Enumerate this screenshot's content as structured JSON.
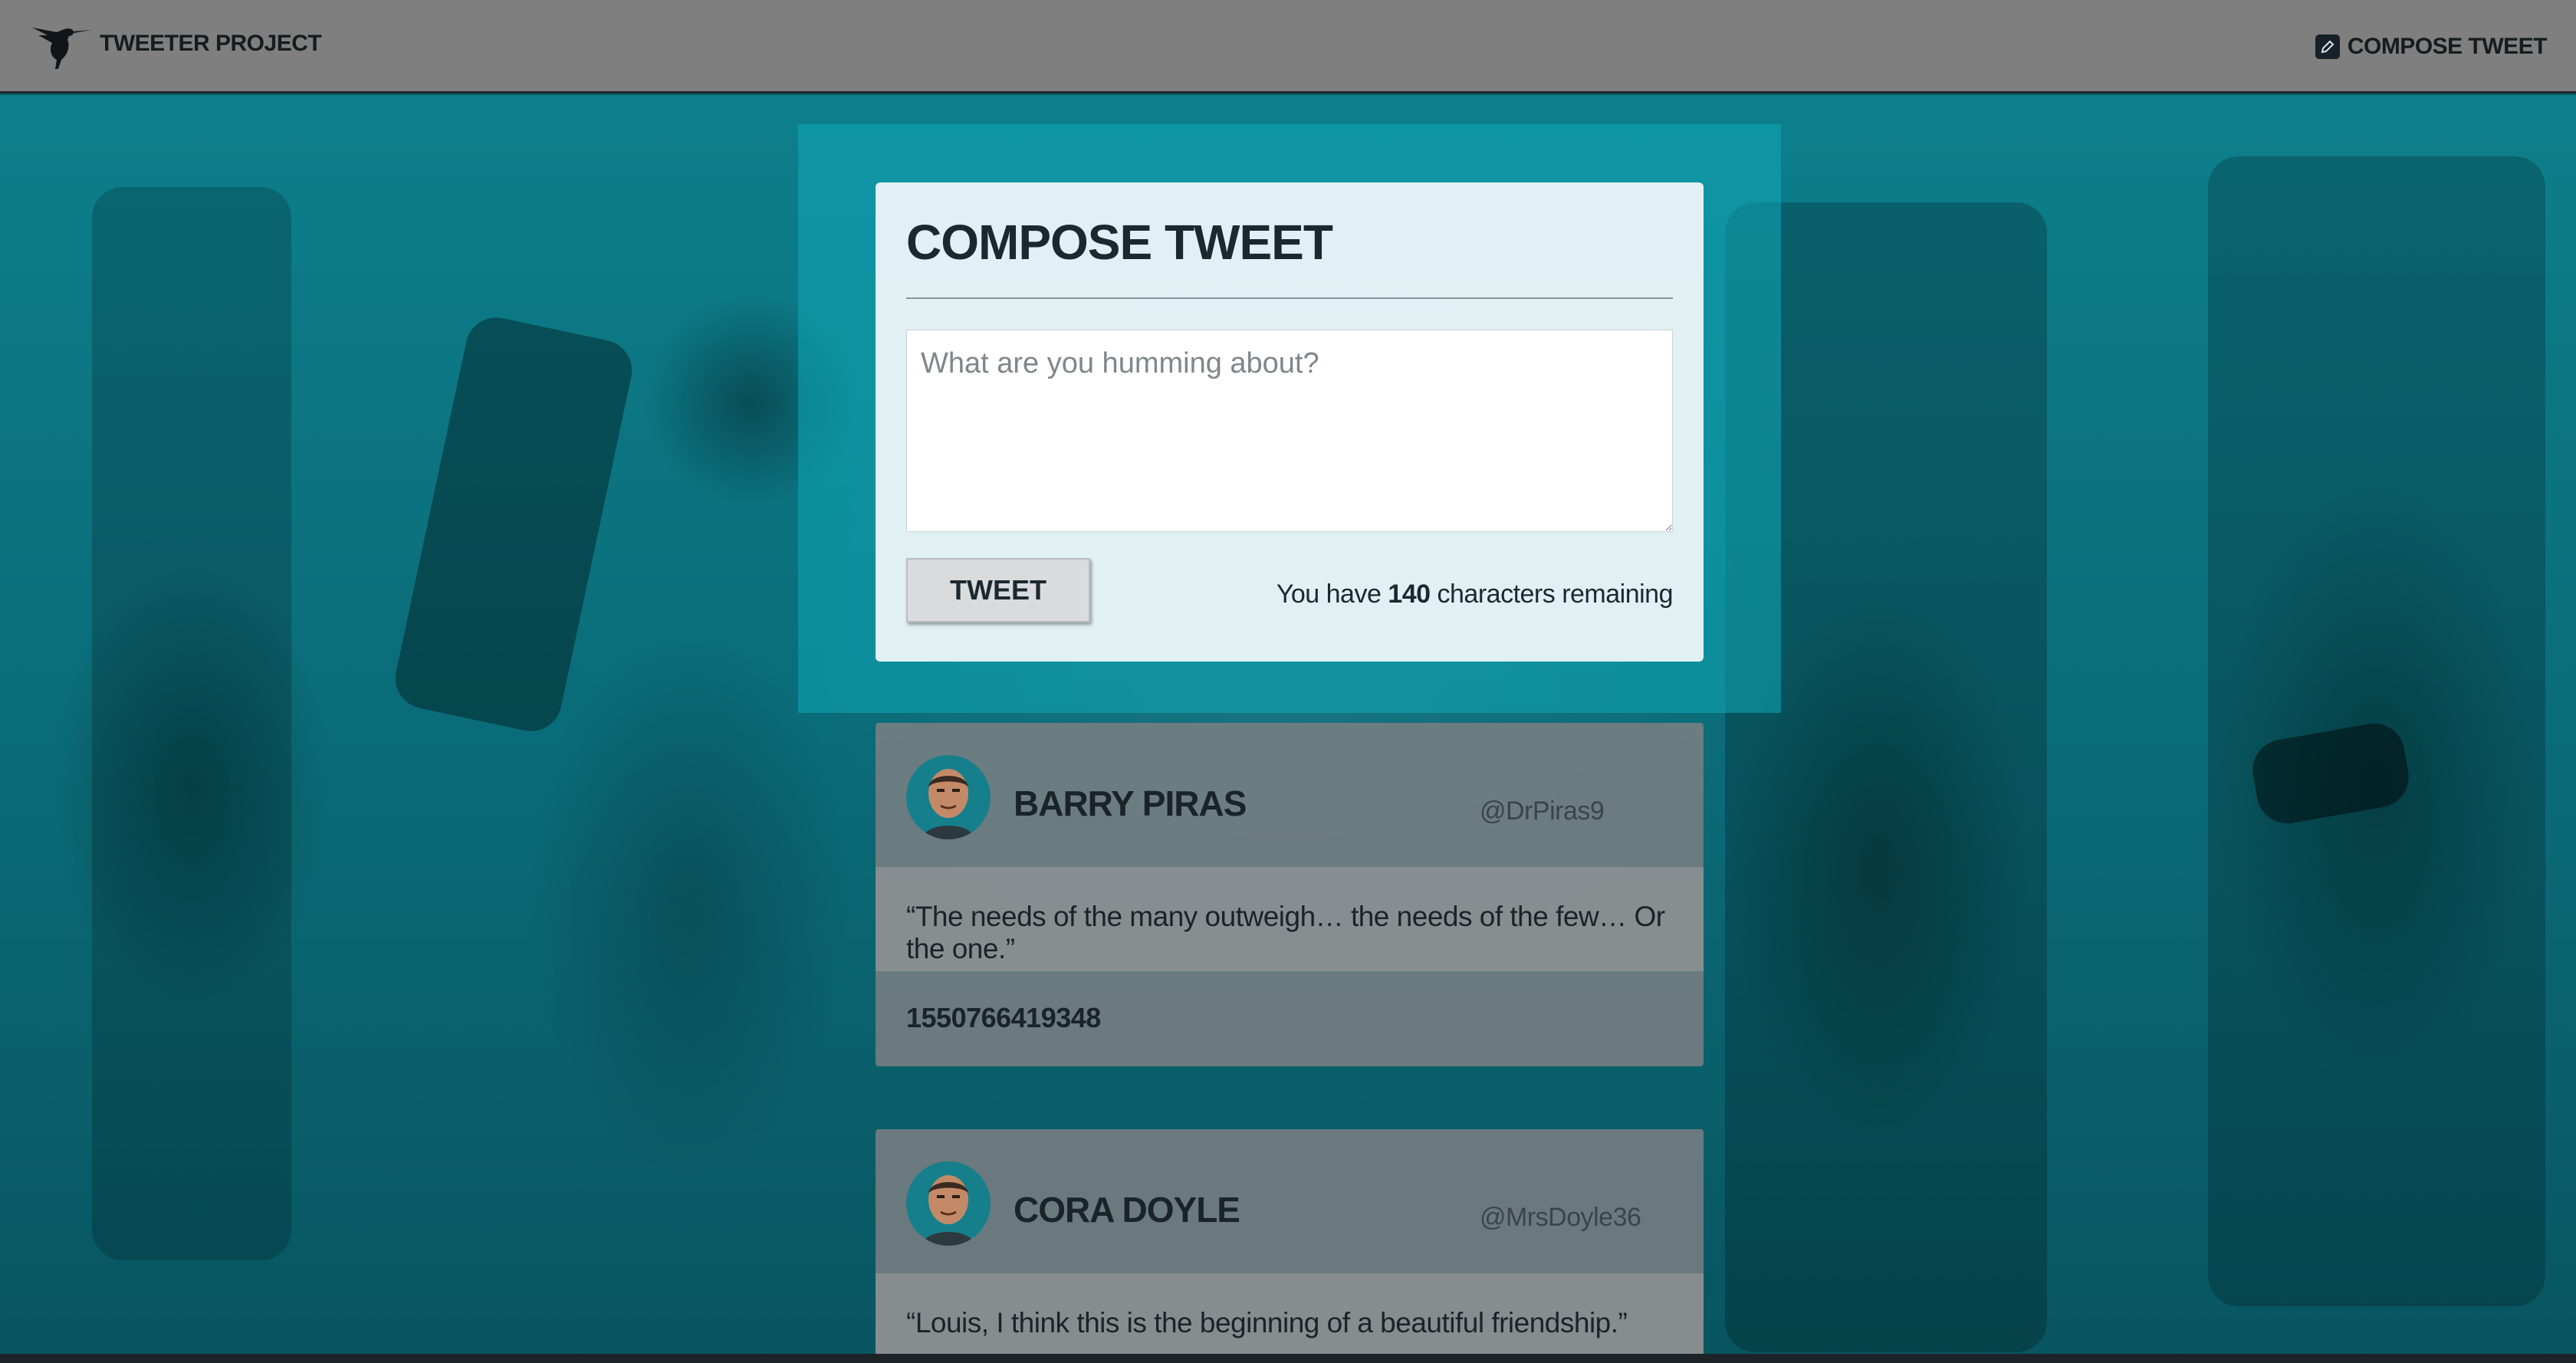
{
  "header": {
    "brand": "TWEETER PROJECT",
    "compose_label": "COMPOSE TWEET"
  },
  "compose": {
    "title": "COMPOSE TWEET",
    "placeholder": "What are you humming about?",
    "button_label": "TWEET",
    "counter_prefix": "You have",
    "counter_value": "140",
    "counter_suffix": "characters remaining"
  },
  "tweets": [
    {
      "name": "BARRY PIRAS",
      "handle": "@DrPiras9",
      "content": "“The needs of the many outweigh… the needs of the few… Or the one.”",
      "timestamp": "1550766419348"
    },
    {
      "name": "CORA DOYLE",
      "handle": "@MrsDoyle36",
      "content": "“Louis, I think this is the beginning of a beautiful friendship.”",
      "timestamp": ""
    }
  ],
  "colors": {
    "accent": "#11a7b8",
    "header_bg": "#7f7f80",
    "text_dark": "#1c2830"
  }
}
